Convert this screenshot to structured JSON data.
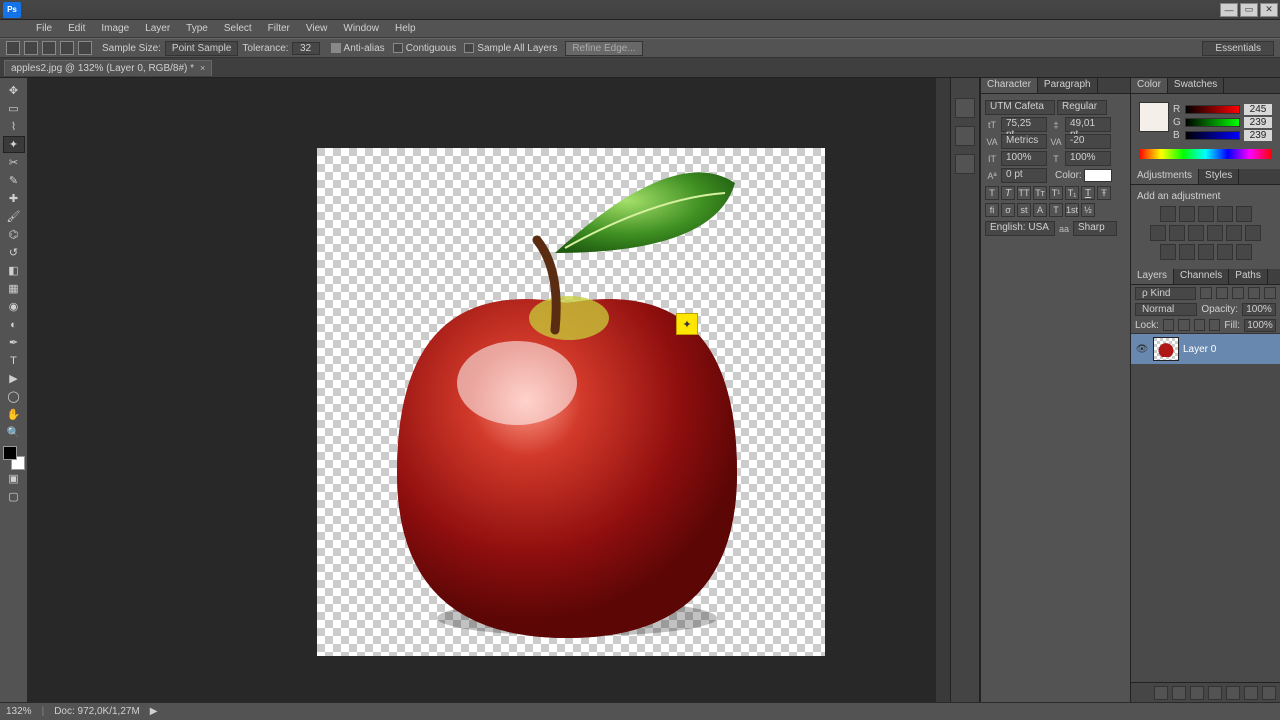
{
  "menubar": [
    "File",
    "Edit",
    "Image",
    "Layer",
    "Type",
    "Select",
    "Filter",
    "View",
    "Window",
    "Help"
  ],
  "options": {
    "sample_size_label": "Sample Size:",
    "sample_size_value": "Point Sample",
    "tolerance_label": "Tolerance:",
    "tolerance_value": "32",
    "anti_alias": "Anti-alias",
    "contiguous": "Contiguous",
    "sample_all": "Sample All Layers",
    "refine": "Refine Edge...",
    "workspace": "Essentials"
  },
  "document": {
    "tab_title": "apples2.jpg @ 132% (Layer 0, RGB/8#) *"
  },
  "panels": {
    "color_tab": "Color",
    "swatches_tab": "Swatches",
    "color": {
      "r": "245",
      "g": "239",
      "b": "239"
    },
    "character_tab": "Character",
    "paragraph_tab": "Paragraph",
    "character": {
      "font": "UTM Cafeta",
      "style": "Regular",
      "size": "75,25 pt",
      "leading": "49,01 pt",
      "kerning": "Metrics",
      "tracking": "-20",
      "vscale": "100%",
      "hscale": "100%",
      "baseline": "0 pt",
      "color_label": "Color:",
      "lang": "English: USA",
      "aa": "Sharp"
    },
    "adjustments_tab": "Adjustments",
    "styles_tab": "Styles",
    "adjustments_hint": "Add an adjustment",
    "layers_tab": "Layers",
    "channels_tab": "Channels",
    "paths_tab": "Paths",
    "layers": {
      "kind": "ρ Kind",
      "blend": "Normal",
      "opacity_label": "Opacity:",
      "opacity": "100%",
      "lock_label": "Lock:",
      "fill_label": "Fill:",
      "fill": "100%",
      "items": [
        {
          "name": "Layer 0"
        }
      ]
    }
  },
  "status": {
    "zoom": "132%",
    "doc": "Doc: 972,0K/1,27M"
  }
}
